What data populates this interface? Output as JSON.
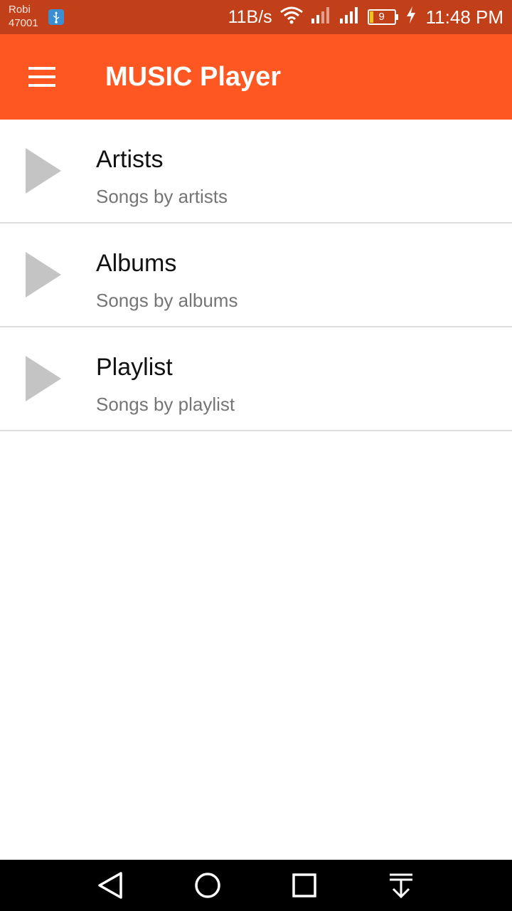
{
  "status_bar": {
    "carrier_name": "Robi",
    "carrier_code": "47001",
    "net_speed": "11B/s",
    "battery_level": "9",
    "time": "11:48 PM",
    "icons": [
      "usb-icon",
      "wifi-icon",
      "signal-icon",
      "signal-icon",
      "battery-icon",
      "charging-icon"
    ]
  },
  "app_bar": {
    "title": "MUSIC Player",
    "color": "#ff5722",
    "menu_icon": "menu-icon"
  },
  "list": {
    "items": [
      {
        "title": "Artists",
        "subtitle": "Songs by artists",
        "icon": "play-icon"
      },
      {
        "title": "Albums",
        "subtitle": "Songs by albums",
        "icon": "play-icon"
      },
      {
        "title": "Playlist",
        "subtitle": "Songs by playlist",
        "icon": "play-icon"
      }
    ]
  },
  "nav_bar": {
    "buttons": [
      "back-icon",
      "home-icon",
      "recents-icon",
      "notifications-pulldown-icon"
    ]
  }
}
